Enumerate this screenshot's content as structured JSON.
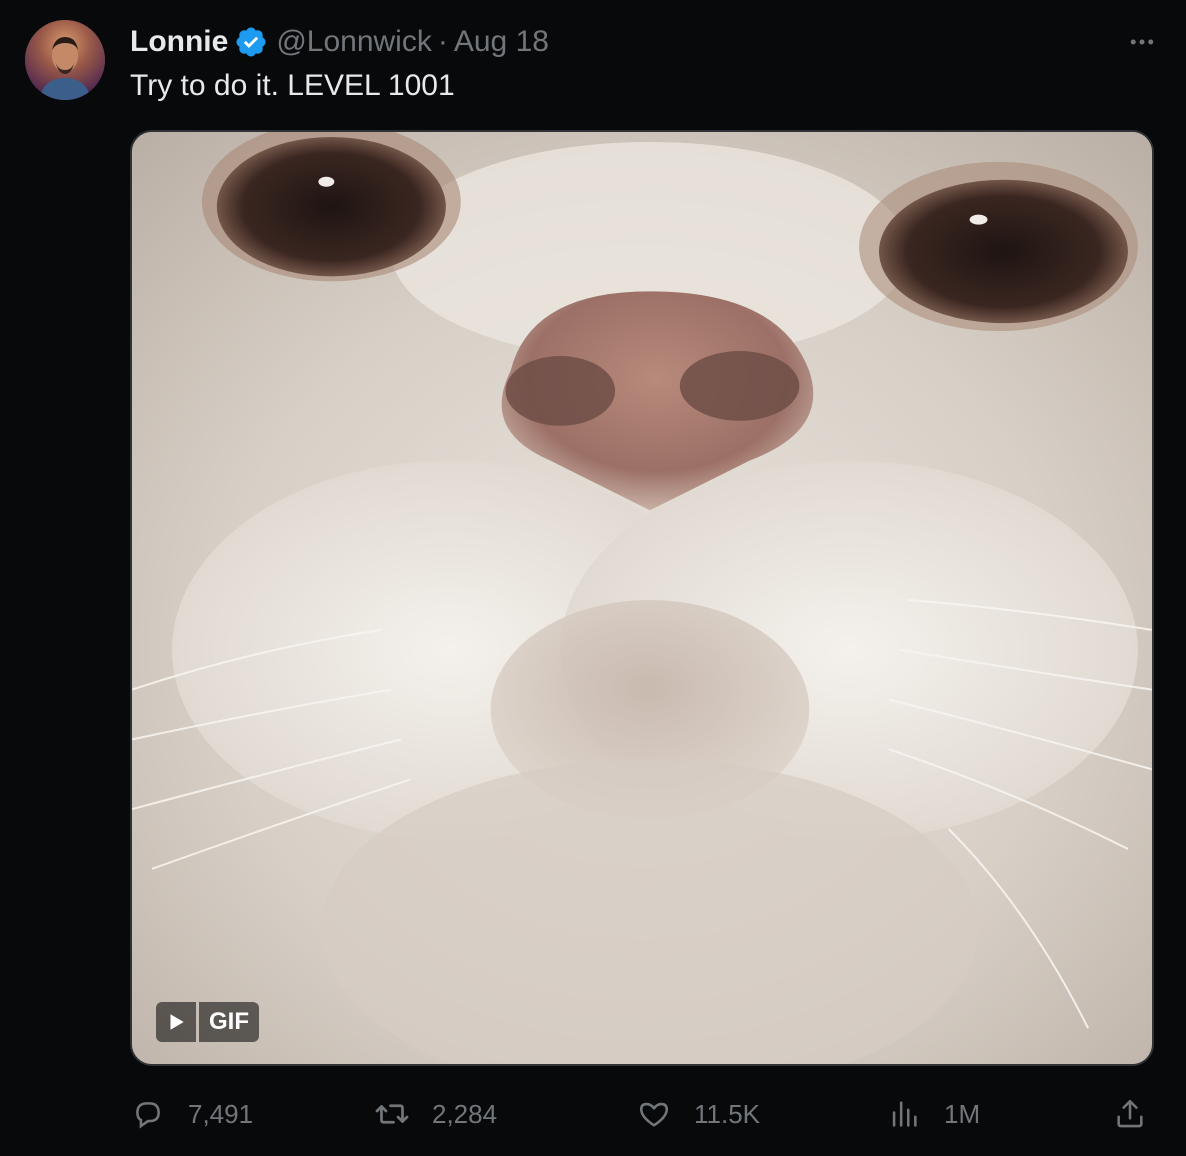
{
  "author": {
    "name": "Lonnie",
    "handle": "@Lonnwick",
    "separator": "·",
    "date": "Aug 18",
    "verified": true
  },
  "tweet": {
    "text": "Try to do it. LEVEL 1001"
  },
  "media": {
    "badge_label": "GIF",
    "icons": [
      "play-icon"
    ]
  },
  "actions": {
    "replies": "7,491",
    "reposts": "2,284",
    "likes": "11.5K",
    "views": "1M"
  },
  "icons": [
    "verified-badge-icon",
    "more-icon",
    "reply-icon",
    "repost-icon",
    "like-icon",
    "views-icon",
    "share-icon"
  ],
  "colors": {
    "background": "#08090a",
    "primary_text": "#e7e9ea",
    "secondary_text": "#71767b",
    "verified_blue": "#1d9bf0",
    "border": "#2f3336"
  }
}
